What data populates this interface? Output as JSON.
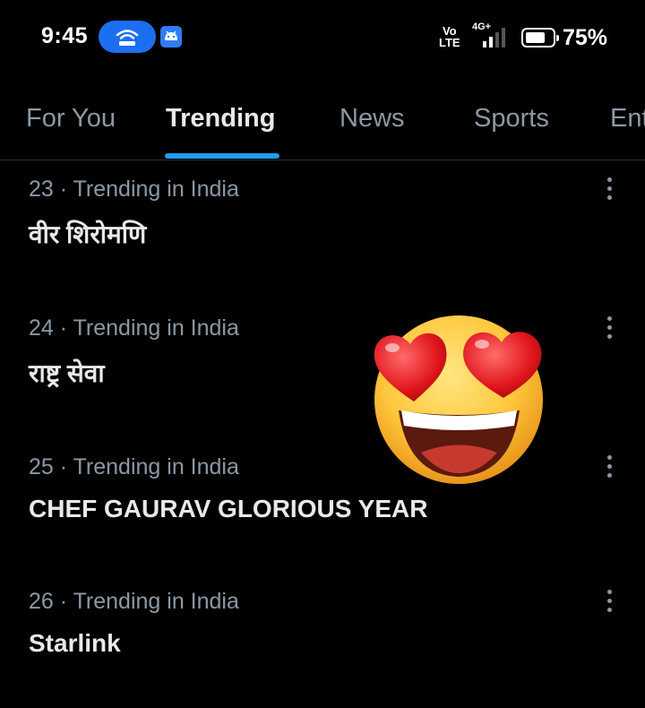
{
  "status_bar": {
    "time": "9:45",
    "volte_line1": "Vo",
    "volte_line2": "LTE",
    "network": "4G+",
    "battery": "75%",
    "battery_level": 0.75,
    "icons": [
      "hotspot-icon",
      "android-icon",
      "signal-icon",
      "battery-icon"
    ]
  },
  "tabs": [
    {
      "label": "For You"
    },
    {
      "label": "Trending"
    },
    {
      "label": "News"
    },
    {
      "label": "Sports"
    },
    {
      "label": "Ent"
    }
  ],
  "active_tab": "Trending",
  "trends": [
    {
      "rank": "23",
      "context": "23 · Trending in India",
      "title": "वीर शिरोमणि"
    },
    {
      "rank": "24",
      "context": "24 · Trending in India",
      "title": "राष्ट्र सेवा"
    },
    {
      "rank": "25",
      "context": "25 · Trending in India",
      "title": "CHEF GAURAV GLORIOUS YEAR"
    },
    {
      "rank": "26",
      "context": "26 · Trending in India",
      "title": "Starlink"
    }
  ],
  "overlay": {
    "icon": "heart-eyes-emoji-icon"
  },
  "colors": {
    "background": "#000000",
    "accent": "#1d9bf0",
    "text_primary": "#e7e9ea",
    "text_secondary": "#8b98a5",
    "pill": "#1d6ff2"
  }
}
